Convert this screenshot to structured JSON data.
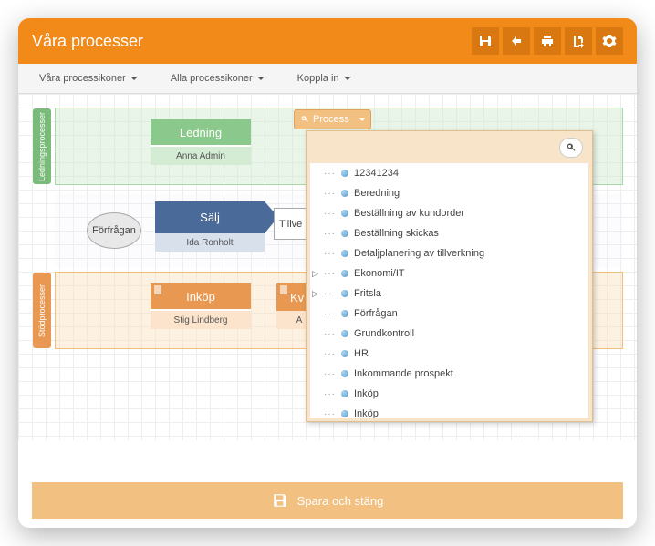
{
  "header": {
    "title": "Våra processer"
  },
  "menubar": {
    "item1": "Våra processikoner",
    "item2": "Alla processikoner",
    "item3": "Koppla in"
  },
  "sections": {
    "ledning_tab": "Ledningsprocesser",
    "stod_tab": "Stödprocesser"
  },
  "boxes": {
    "ledning": {
      "title": "Ledning",
      "owner": "Anna Admin"
    },
    "forfragan": "Förfrågan",
    "salj": {
      "title": "Sälj",
      "owner": "Ida Ronholt"
    },
    "tillv": "Tillve",
    "inkop": {
      "title": "Inköp",
      "owner": "Stig Lindberg"
    },
    "kv": {
      "title": "Kv",
      "owner": "A"
    }
  },
  "dropdown": {
    "trigger": "Process",
    "items": [
      "12341234",
      "Beredning",
      "Beställning av kundorder",
      "Beställning skickas",
      "Detaljplanering av tillverkning",
      "Ekonomi/IT",
      "Fritsla",
      "Förfrågan",
      "Grundkontroll",
      "HR",
      "Inkommande prospekt",
      "Inköp",
      "Inköp"
    ],
    "expandable": [
      5,
      6
    ]
  },
  "footer": {
    "save": "Spara och stäng"
  }
}
